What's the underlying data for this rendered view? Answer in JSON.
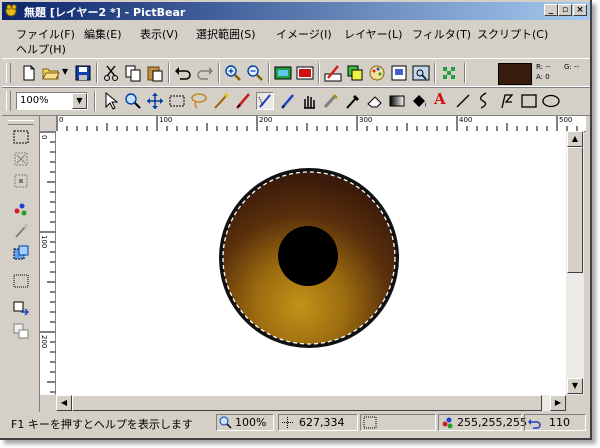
{
  "window": {
    "title": "無題 [レイヤー2 *] - PictBear"
  },
  "menu": [
    "ファイル(F)",
    "編集(E)",
    "表示(V)",
    "選択範囲(S)",
    "イメージ(I)",
    "レイヤー(L)",
    "フィルタ(T)",
    "スクリプト(C)",
    "ヘルプ(H)"
  ],
  "zoom": {
    "value": "100%"
  },
  "color_panel": {
    "fg_color": "#3a1c0c",
    "r_label": "R: --",
    "a_label": "A: 0",
    "g_label": "G: --"
  },
  "ruler": {
    "h_ticks": [
      "0",
      "100",
      "200",
      "300",
      "400",
      "500"
    ],
    "v_ticks": [
      "0",
      "100",
      "200"
    ]
  },
  "status": {
    "help": "F1 キーを押すとヘルプを表示します",
    "zoom": "100%",
    "position": "627,334",
    "color": "255,255,255",
    "undo": "110"
  }
}
